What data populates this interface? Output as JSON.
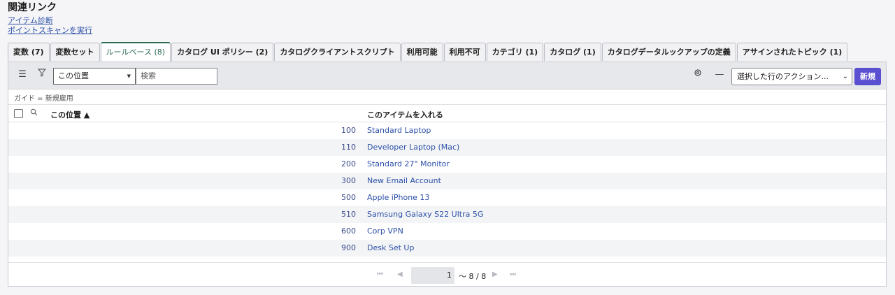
{
  "page": {
    "title": "関連リンク",
    "links": [
      "アイテム診断",
      "ポイントスキャンを実行"
    ]
  },
  "tabs": [
    {
      "label": "変数 (7)",
      "active": false
    },
    {
      "label": "変数セット",
      "active": false
    },
    {
      "label": "ルールベース (8)",
      "active": true
    },
    {
      "label": "カタログ UI ポリシー (2)",
      "active": false
    },
    {
      "label": "カタログクライアントスクリプト",
      "active": false
    },
    {
      "label": "利用可能",
      "active": false
    },
    {
      "label": "利用不可",
      "active": false
    },
    {
      "label": "カテゴリ (1)",
      "active": false
    },
    {
      "label": "カタログ (1)",
      "active": false
    },
    {
      "label": "カタログデータルックアップの定義",
      "active": false
    },
    {
      "label": "アサインされたトピック (1)",
      "active": false
    }
  ],
  "toolbar": {
    "field_select": "この位置",
    "search_placeholder": "検索",
    "action_select": "選択した行のアクション...",
    "new_label": "新規"
  },
  "breadcrumb": "ガイド = 新規雇用",
  "table": {
    "columns": [
      "この位置 ▲",
      "このアイテムを入れる"
    ],
    "rows": [
      {
        "order": "100",
        "item": "Standard Laptop"
      },
      {
        "order": "110",
        "item": "Developer Laptop (Mac)"
      },
      {
        "order": "200",
        "item": "Standard 27\" Monitor"
      },
      {
        "order": "300",
        "item": "New Email Account"
      },
      {
        "order": "500",
        "item": "Apple iPhone 13"
      },
      {
        "order": "510",
        "item": "Samsung Galaxy S22 Ultra 5G"
      },
      {
        "order": "600",
        "item": "Corp VPN"
      },
      {
        "order": "900",
        "item": "Desk Set Up"
      }
    ]
  },
  "pager": {
    "current": "1",
    "range_text": "〜 8 / 8"
  },
  "colors": {
    "accent": "#2e6b55",
    "primary_button": "#5b4fd1",
    "link": "#2b4fa8"
  }
}
